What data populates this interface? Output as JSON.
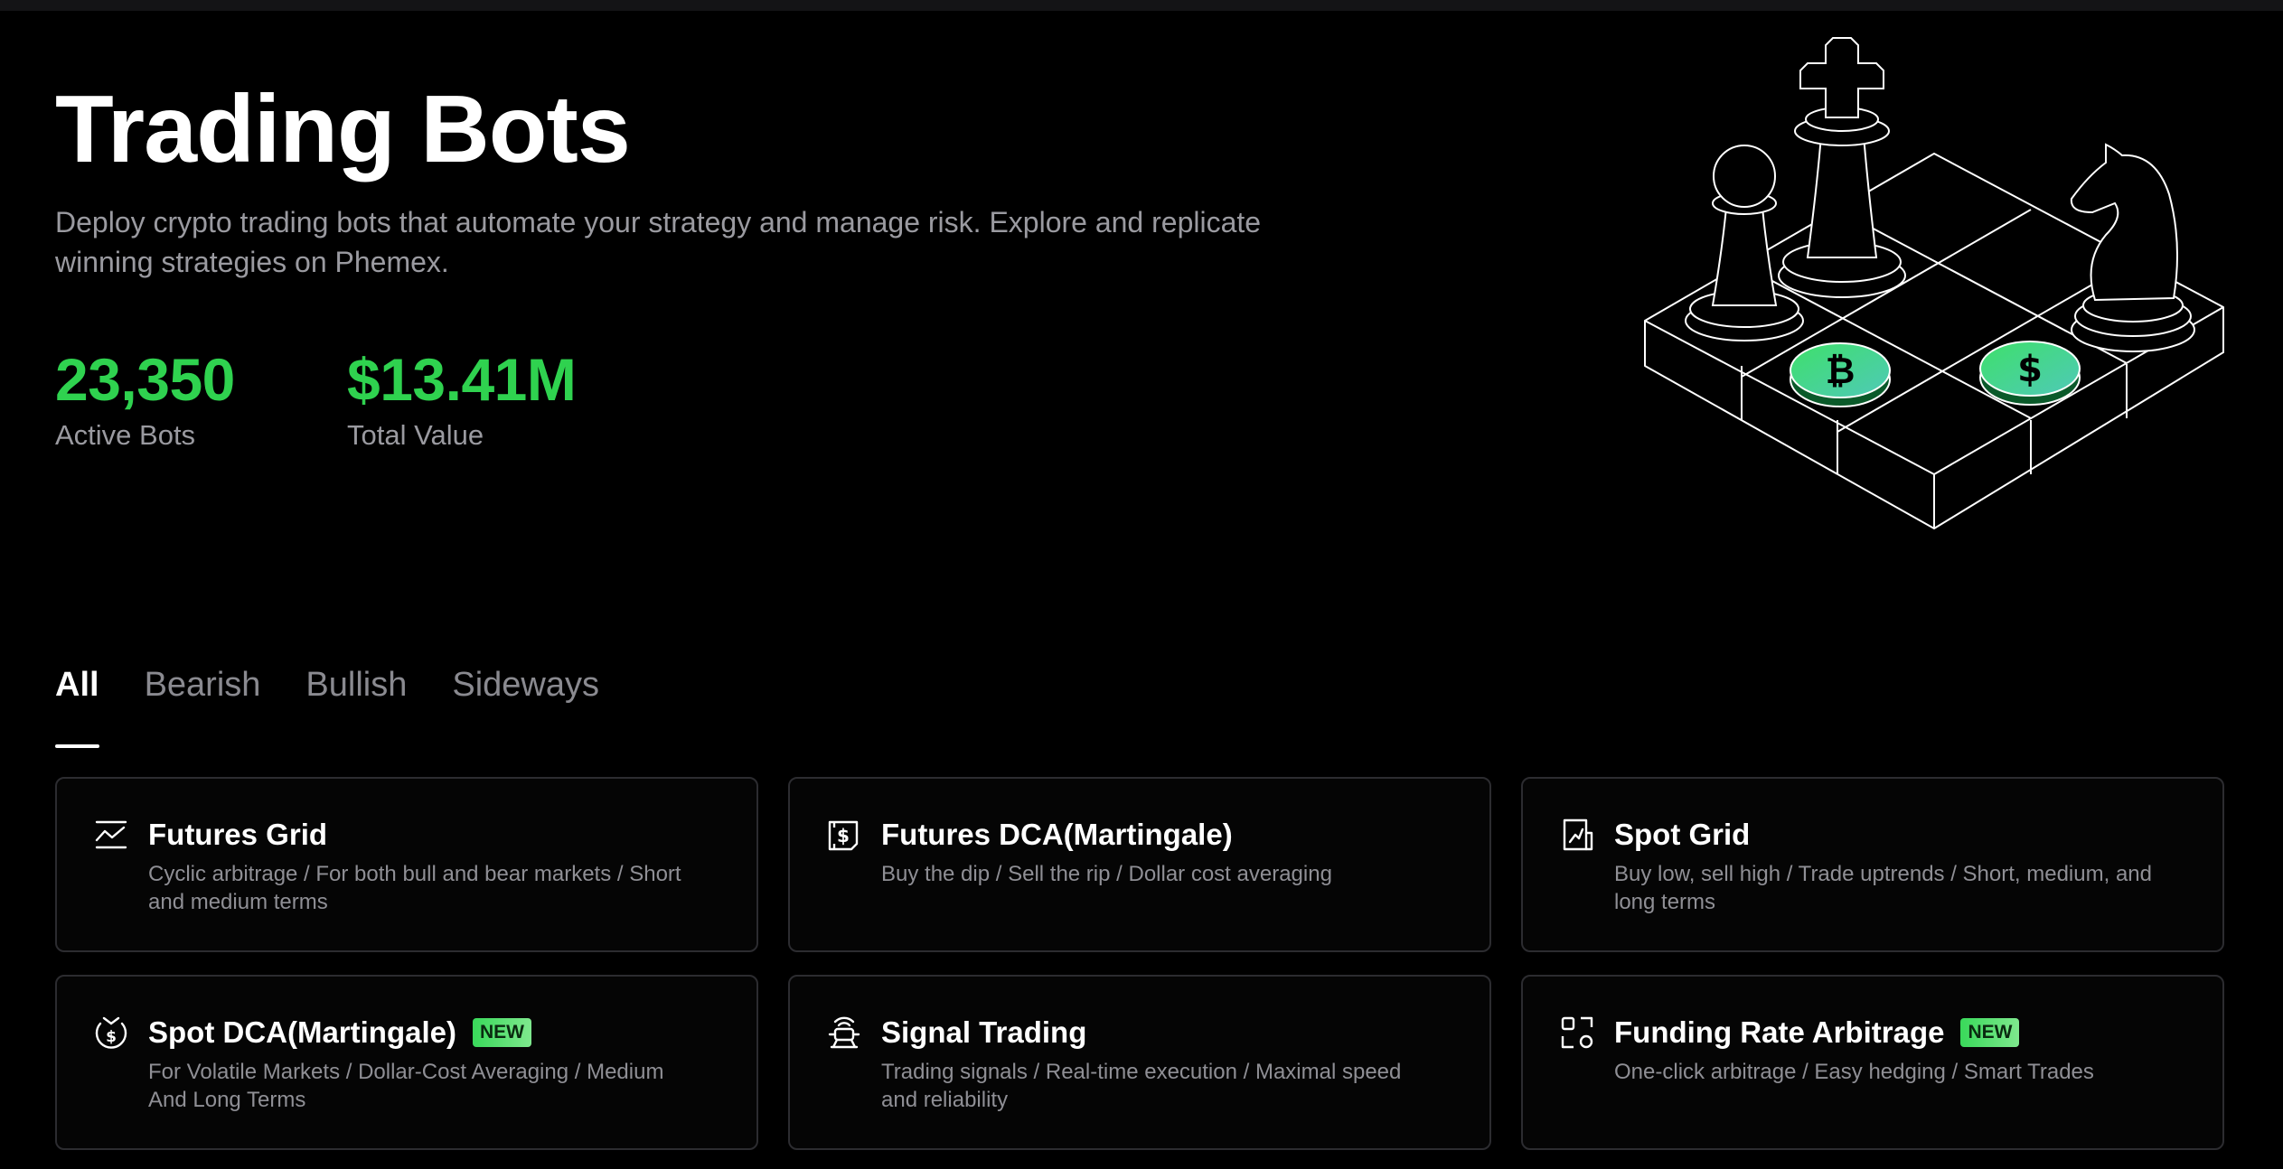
{
  "hero": {
    "title": "Trading Bots",
    "description": "Deploy crypto trading bots that automate your strategy and manage risk. Explore and replicate winning strategies on Phemex."
  },
  "stats": [
    {
      "value": "23,350",
      "label": "Active Bots"
    },
    {
      "value": "$13.41M",
      "label": "Total Value"
    }
  ],
  "tabs": [
    {
      "label": "All",
      "active": true
    },
    {
      "label": "Bearish",
      "active": false
    },
    {
      "label": "Bullish",
      "active": false
    },
    {
      "label": "Sideways",
      "active": false
    }
  ],
  "cards": [
    {
      "icon": "chart-line-icon",
      "title": "Futures Grid",
      "badge": "",
      "desc": "Cyclic arbitrage / For both bull and bear markets / Short and medium terms"
    },
    {
      "icon": "dollar-document-icon",
      "title": "Futures DCA(Martingale)",
      "badge": "",
      "desc": "Buy the dip / Sell the rip / Dollar cost averaging"
    },
    {
      "icon": "spot-grid-icon",
      "title": "Spot Grid",
      "badge": "",
      "desc": "Buy low, sell high / Trade uptrends / Short, medium, and long terms"
    },
    {
      "icon": "dollar-cycle-icon",
      "title": "Spot DCA(Martingale)",
      "badge": "NEW",
      "desc": "For Volatile Markets / Dollar-Cost Averaging / Medium And Long Terms"
    },
    {
      "icon": "signal-robot-icon",
      "title": "Signal Trading",
      "badge": "",
      "desc": "Trading signals / Real-time execution / Maximal speed and reliability"
    },
    {
      "icon": "arbitrage-shapes-icon",
      "title": "Funding Rate Arbitrage",
      "badge": "NEW",
      "desc": "One-click arbitrage / Easy hedging / Smart Trades"
    }
  ],
  "colors": {
    "accent": "#2fd24f",
    "background": "#000000",
    "card_border": "#2c2c30"
  }
}
